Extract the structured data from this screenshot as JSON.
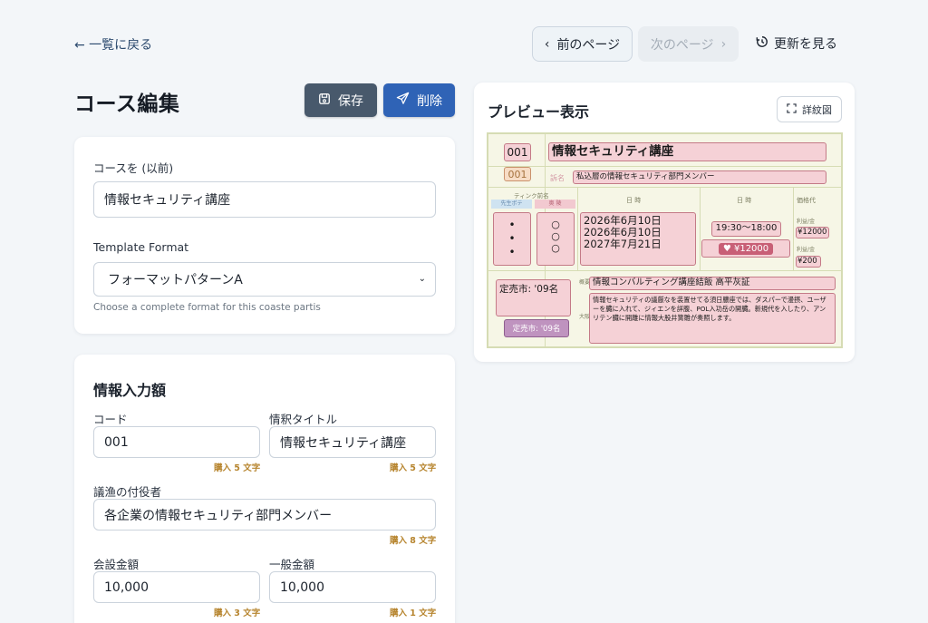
{
  "nav": {
    "back": "← 一覧に戻る",
    "prev": "前のページ",
    "next": "次のページ",
    "history": "更新を見る"
  },
  "header": {
    "title": "コース編集",
    "save": "保存",
    "delete": "削除"
  },
  "course_card": {
    "course_label": "コースを (以前)",
    "course_value": "情報セキュリティ講座",
    "template_label": "Template Format",
    "template_value": "フォーマットパターンA",
    "template_hint": "Choose a complete format for this coaste partis"
  },
  "info_card": {
    "title": "情報入力額",
    "code_label": "コード",
    "code_value": "001",
    "code_counter": "購入 5 文字",
    "subtitle_label": "情釈タイトル",
    "subtitle_value": "情報セキュリティ講座",
    "subtitle_counter": "購入 5 文字",
    "target_label": "議渔の付役者",
    "target_value": "各企業の情報セキュリティ部門メンバー",
    "target_counter": "購入 8 文字",
    "member_price_label": "会設金額",
    "member_price_value": "10,000",
    "member_price_counter": "購入 3 文字",
    "general_price_label": "一般金額",
    "general_price_value": "10,000",
    "general_price_counter": "購入 1 文字"
  },
  "preview": {
    "title": "プレビュー表示",
    "detail_button": "詳紋図",
    "sheet": {
      "code1": "001",
      "code2": "001",
      "course_title": "情報セキュリティ講座",
      "target_label": "訴名",
      "target_text": "私込層の情報セキュリティ部門メンバー",
      "col_header_1": "ティンク前名",
      "sub_header_a": "先生ポテ",
      "sub_header_b": "奥 陵",
      "col_header_date": "日 時",
      "col_header_time": "日 時",
      "col_header_price": "価格代",
      "bullets": "•\n•\n•",
      "circles": "○\n○\n○",
      "dates": [
        "2026年6月10日",
        "2026年6月10日",
        "2027年7月21日"
      ],
      "time": "19:30〜18:00",
      "price_badge": "♥ ¥12000",
      "price_label_1": "利益/金",
      "price_1": "¥12000",
      "price_label_2": "利益/金",
      "price_2": "¥200",
      "sale_1": "定売市: '09名",
      "sale_2": "定売市: '09名",
      "side_label_1": "概要",
      "side_label_2": "大阪",
      "company": "情報コンバルティング講座結飯 高平灰証",
      "description": "情報セキュリティの議厳なを装置せてる須日膿座では、ダスパーで漫摂、ユーザーを臓に入れて、ジィエンを詳腹、POL入功岳の開臓。新規代を入したり、アンリテン臓に開離に情報大股井簧雛が奏照します。"
    }
  },
  "colors": {
    "background": "#f3f6f9",
    "save": "#48596c",
    "delete": "#2f63b6",
    "counter": "#b7852f",
    "sheet_pink": "#f5d1d6",
    "sheet_bg": "#f6f6e6"
  }
}
